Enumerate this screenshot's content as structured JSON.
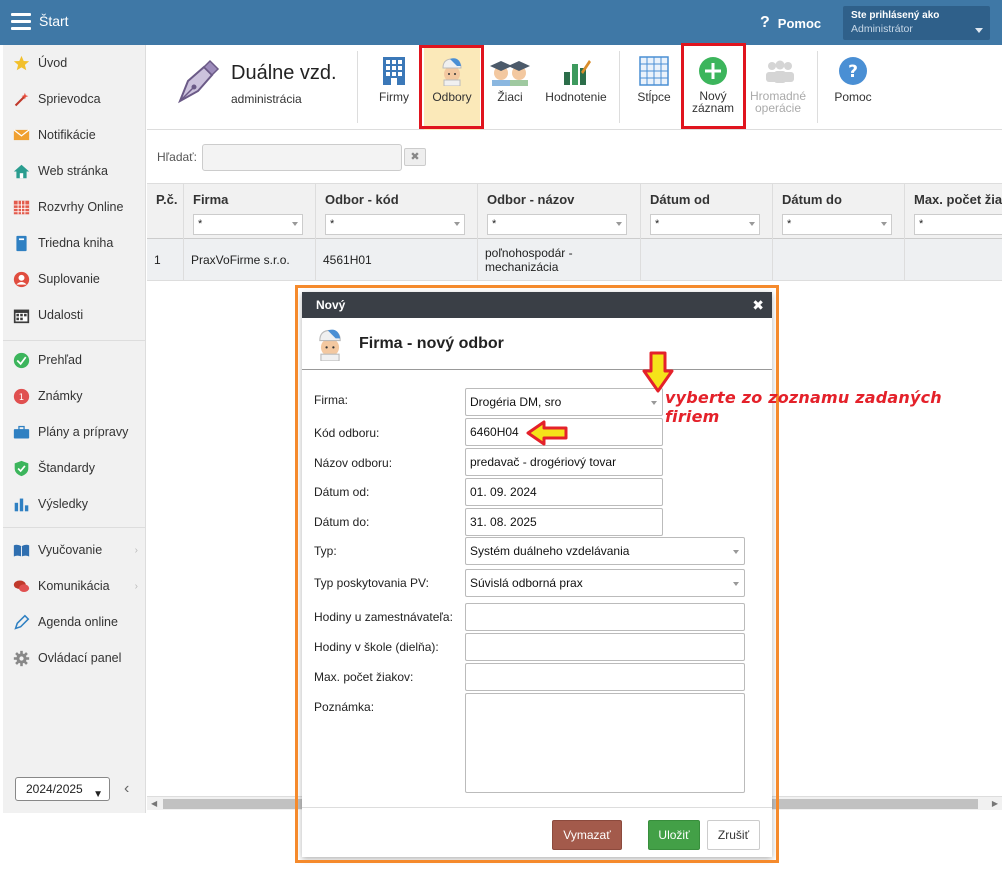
{
  "topbar": {
    "app_title": "Štart",
    "help_label": "Pomoc",
    "user_caption": "Ste prihlásený ako",
    "user_role": "Administrátor"
  },
  "sidebar": {
    "items": [
      {
        "label": "Úvod",
        "icon": "star-icon"
      },
      {
        "label": "Sprievodca",
        "icon": "magic-wand-icon"
      },
      {
        "label": "Notifikácie",
        "icon": "envelope-icon"
      },
      {
        "label": "Web stránka",
        "icon": "home-icon"
      },
      {
        "label": "Rozvrhy Online",
        "icon": "calendar-grid-icon"
      },
      {
        "label": "Triedna kniha",
        "icon": "book-icon"
      },
      {
        "label": "Suplovanie",
        "icon": "person-icon"
      },
      {
        "label": "Udalosti",
        "icon": "calendar-icon"
      },
      {
        "label": "Prehľad",
        "icon": "check-circle-icon"
      },
      {
        "label": "Známky",
        "icon": "grade-icon"
      },
      {
        "label": "Plány a prípravy",
        "icon": "briefcase-icon"
      },
      {
        "label": "Štandardy",
        "icon": "shield-check-icon"
      },
      {
        "label": "Výsledky",
        "icon": "bar-chart-icon"
      },
      {
        "label": "Vyučovanie",
        "icon": "open-book-icon"
      },
      {
        "label": "Komunikácia",
        "icon": "chat-icon"
      },
      {
        "label": "Agenda online",
        "icon": "pen-icon"
      },
      {
        "label": "Ovládací panel",
        "icon": "gear-icon"
      }
    ],
    "year": "2024/2025"
  },
  "toolbar": {
    "title": "Duálne vzd.",
    "subtitle": "administrácia",
    "buttons": {
      "firmy": "Firmy",
      "odbory": "Odbory",
      "ziaci": "Žiaci",
      "hodnotenie": "Hodnotenie",
      "stlpce": "Stĺpce",
      "novy_line1": "Nový",
      "novy_line2": "záznam",
      "hromadne_line1": "Hromadné",
      "hromadne_line2": "operácie",
      "pomoc": "Pomoc"
    }
  },
  "search": {
    "label": "Hľadať:",
    "clear": "✖"
  },
  "grid": {
    "columns": [
      "P.č.",
      "Firma",
      "Odbor - kód",
      "Odbor - názov",
      "Dátum od",
      "Dátum do",
      "Max. počet žia"
    ],
    "filter_value": "*",
    "rows": [
      {
        "pc": "1",
        "firma": "PraxVoFirme s.r.o.",
        "kod": "4561H01",
        "nazov_l1": "poľnohospodár -",
        "nazov_l2": "mechanizácia",
        "od": "",
        "do": "",
        "max": ""
      }
    ]
  },
  "modal": {
    "window_title": "Nový",
    "close": "✖",
    "heading": "Firma - nový odbor",
    "fields": {
      "firma_label": "Firma:",
      "firma_value": "Drogéria DM, sro",
      "kod_label": "Kód odboru:",
      "kod_value": "6460H04",
      "nazov_label": "Názov odboru:",
      "nazov_value": "predavač - drogériový tovar",
      "od_label": "Dátum od:",
      "od_value": "01. 09. 2024",
      "do_label": "Dátum do:",
      "do_value": "31. 08. 2025",
      "typ_label": "Typ:",
      "typ_value": "Systém duálneho vzdelávania",
      "typpv_label": "Typ poskytovania PV:",
      "typpv_value": "Súvislá odborná prax",
      "hodiny_zam_label": "Hodiny u zamestnávateľa:",
      "hodiny_zam_value": "",
      "hodiny_skola_label": "Hodiny v škole (dielňa):",
      "hodiny_skola_value": "",
      "max_label": "Max. počet žiakov:",
      "max_value": "",
      "poznamka_label": "Poznámka:",
      "poznamka_value": ""
    },
    "buttons": {
      "delete": "Vymazať",
      "save": "Uložiť",
      "cancel": "Zrušiť"
    }
  },
  "annotation": {
    "text": "vyberte zo zoznamu zadaných firiem"
  },
  "colors": {
    "topbar": "#3f78a6",
    "highlight_red": "#e0141e",
    "modal_frame_orange": "#f58a2c",
    "annotation_red": "#e4212a",
    "arrow_yellow": "#f5e31a"
  }
}
